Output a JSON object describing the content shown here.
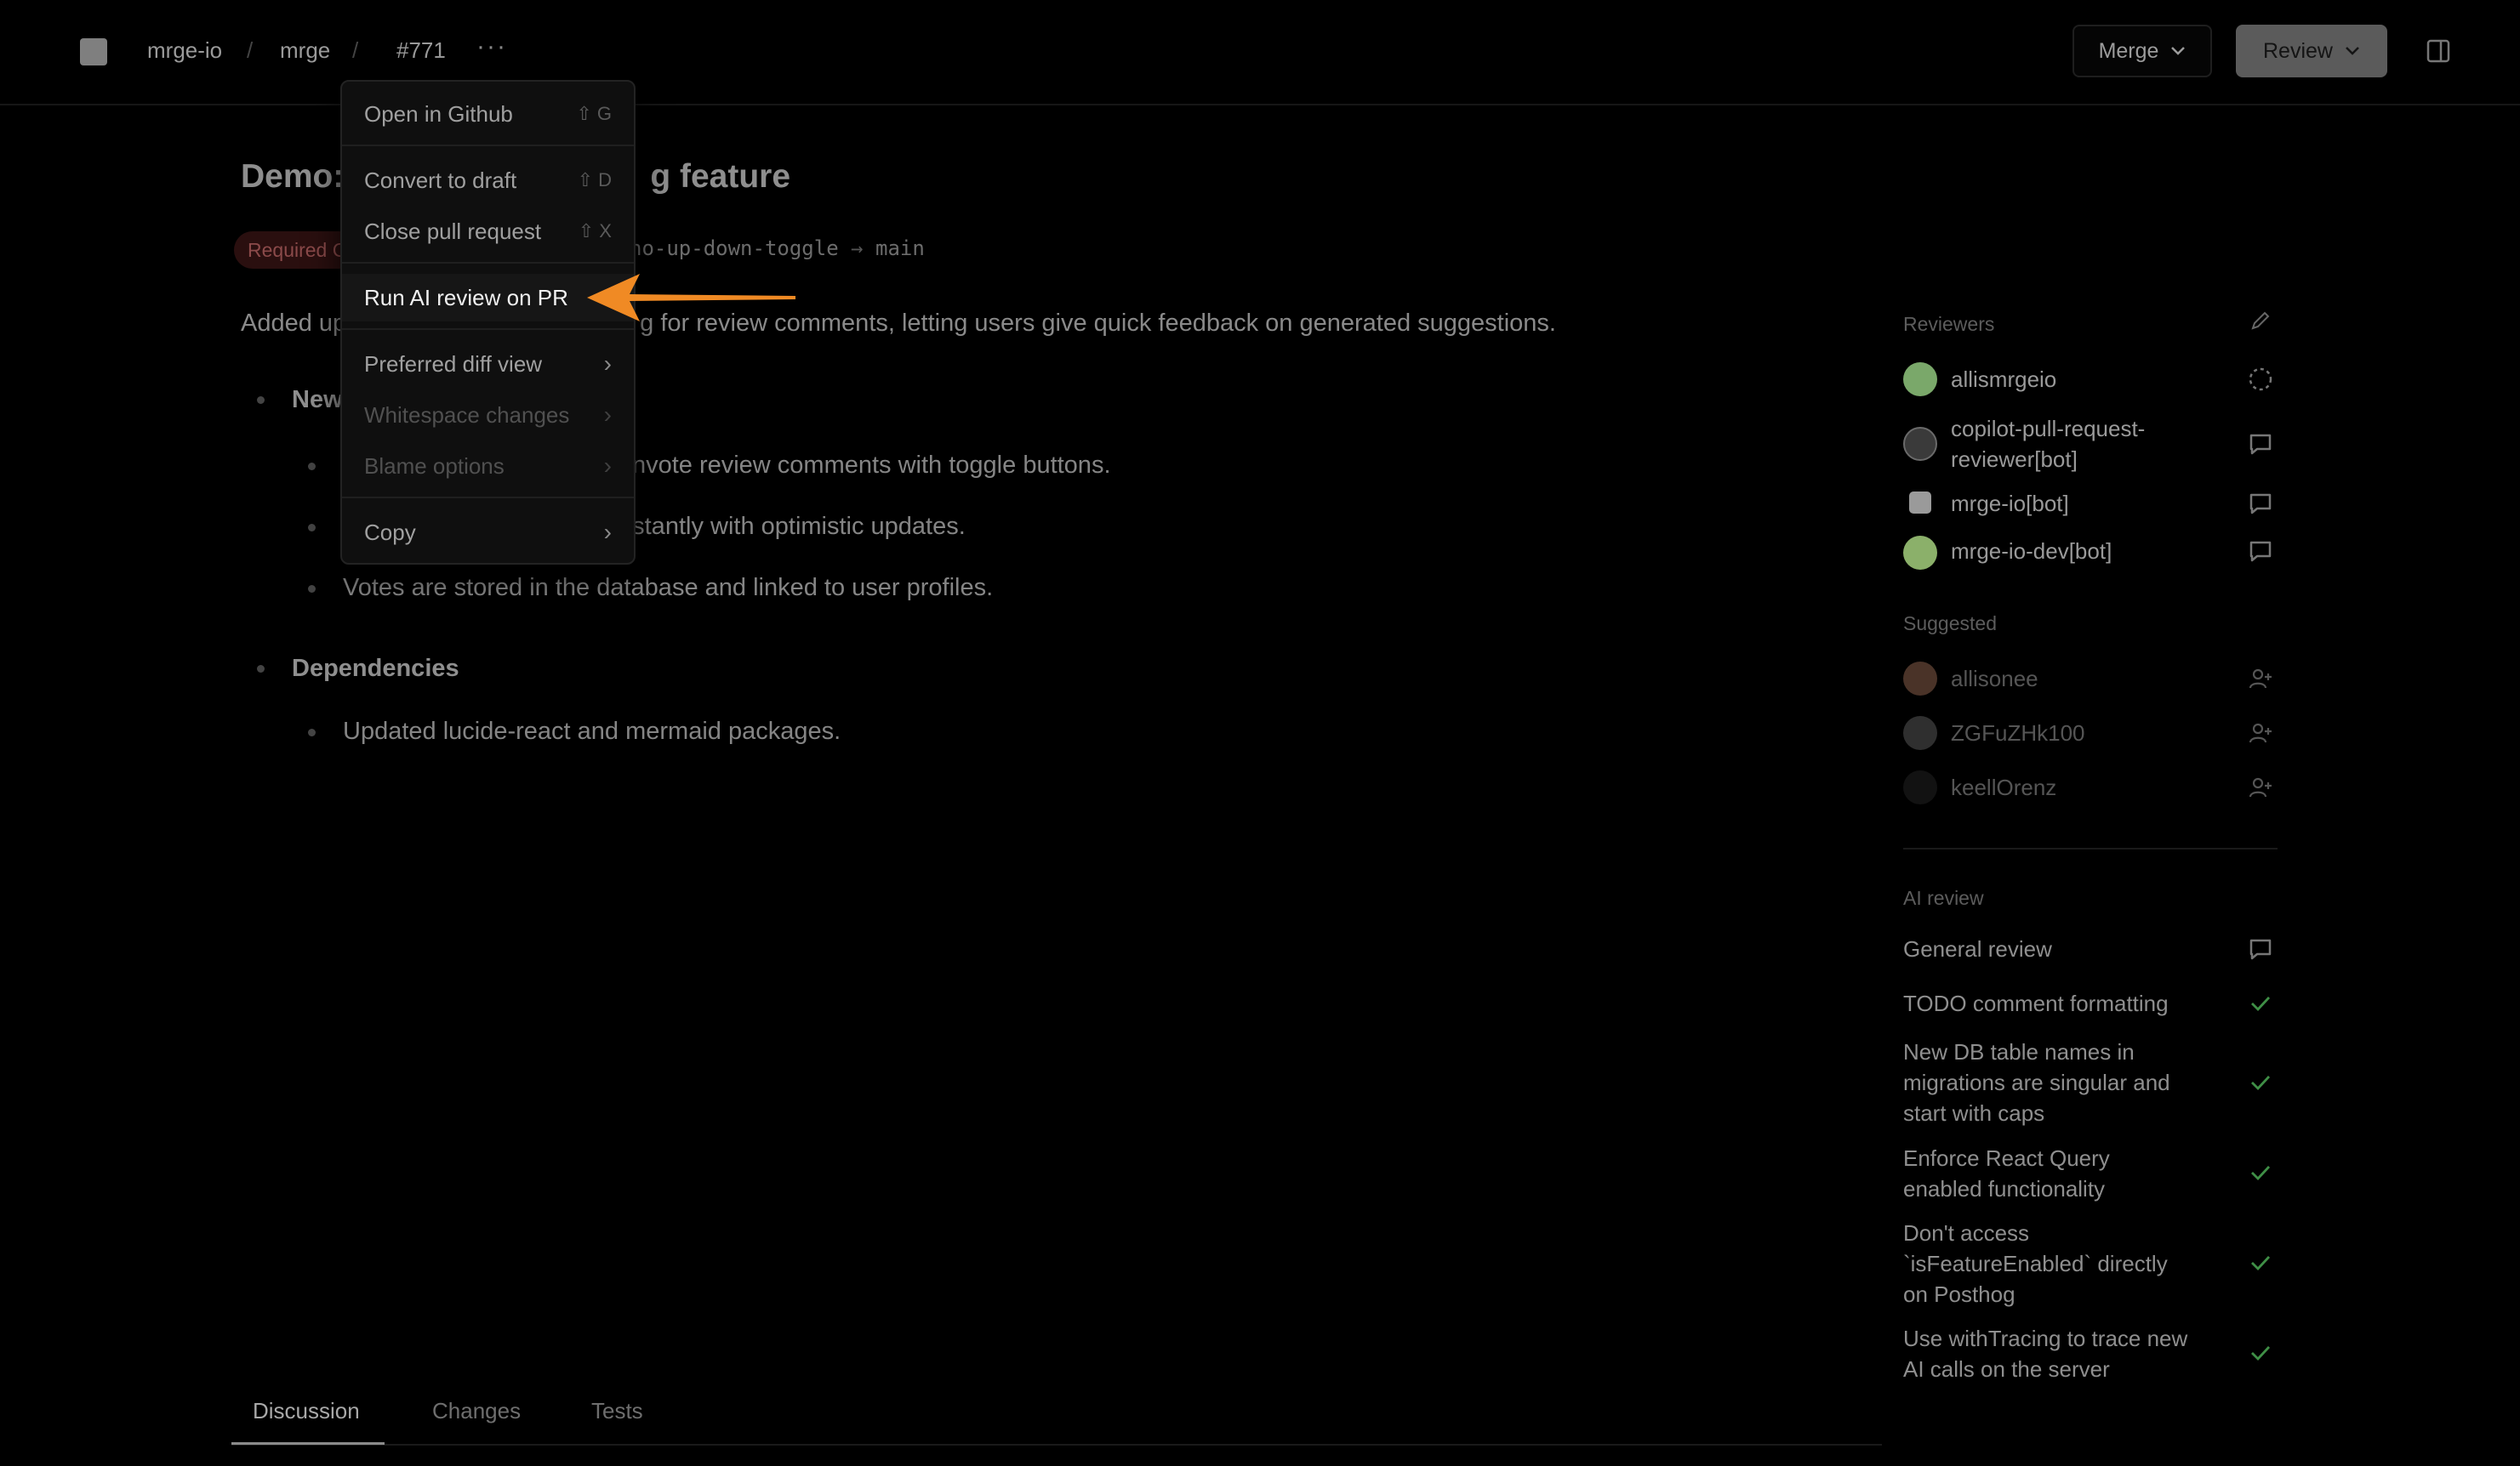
{
  "breadcrumb": {
    "org": "mrge-io",
    "repo": "mrge",
    "pr": "#771"
  },
  "header": {
    "merge_label": "Merge",
    "review_label": "Review"
  },
  "pr": {
    "title_visible": "Demo:",
    "title_tail": "g feature",
    "badge": "Required C",
    "branch_from": "no-up-down-toggle",
    "branch_to": "main",
    "description_start": "Added up",
    "description_end": "g for review comments, letting users give quick feedback on generated suggestions.",
    "sections": [
      {
        "heading": "New",
        "items": [
          "wnvote review comments with toggle buttons.",
          "nstantly with optimistic updates.",
          "Votes are stored in the database and linked to user profiles."
        ]
      },
      {
        "heading": "Dependencies",
        "items": [
          "Updated lucide-react and mermaid packages."
        ]
      }
    ]
  },
  "tabs": [
    "Discussion",
    "Changes",
    "Tests"
  ],
  "sidebar": {
    "reviewers_heading": "Reviewers",
    "reviewers": [
      {
        "name": "allismrgeio",
        "status_icon": "pending-circle-icon",
        "avatar_color": "#7aa86a"
      },
      {
        "name": "copilot-pull-request-reviewer[bot]",
        "status_icon": "comment-icon",
        "avatar_color": "#6a6a6a"
      },
      {
        "name": "mrge-io[bot]",
        "status_icon": "comment-icon",
        "avatar_color": "#9a9a9a"
      },
      {
        "name": "mrge-io-dev[bot]",
        "status_icon": "comment-icon",
        "avatar_color": "#8bb06a"
      }
    ],
    "suggested_heading": "Suggested",
    "suggested": [
      {
        "name": "allisonee",
        "avatar_color": "#6a4a3a"
      },
      {
        "name": "ZGFuZHk100",
        "avatar_color": "#3a3a3a"
      },
      {
        "name": "keellOrenz",
        "avatar_color": "#1a1a1a"
      }
    ],
    "ai_heading": "AI review",
    "ai_items": [
      {
        "label": "General review",
        "icon": "comment-icon"
      },
      {
        "label": "TODO comment formatting",
        "icon": "check-icon"
      },
      {
        "label": "New DB table names in migrations are singular and start with caps",
        "icon": "check-icon"
      },
      {
        "label": "Enforce React Query enabled functionality",
        "icon": "check-icon"
      },
      {
        "label": "Don't access `isFeatureEnabled` directly on Posthog",
        "icon": "check-icon"
      },
      {
        "label": "Use withTracing to trace new AI calls on the server",
        "icon": "check-icon"
      }
    ]
  },
  "menu": {
    "open_github": "Open in Github",
    "open_github_kbd": "⇧ G",
    "convert_draft": "Convert to draft",
    "convert_draft_kbd": "⇧ D",
    "close_pr": "Close pull request",
    "close_pr_kbd": "⇧ X",
    "run_ai": "Run AI review on PR",
    "preferred_diff": "Preferred diff view",
    "whitespace": "Whitespace changes",
    "blame": "Blame options",
    "copy": "Copy"
  },
  "colors": {
    "accent_arrow": "#f08a24",
    "check_green": "#4caf50",
    "badge_bg": "#2a0f0f"
  }
}
